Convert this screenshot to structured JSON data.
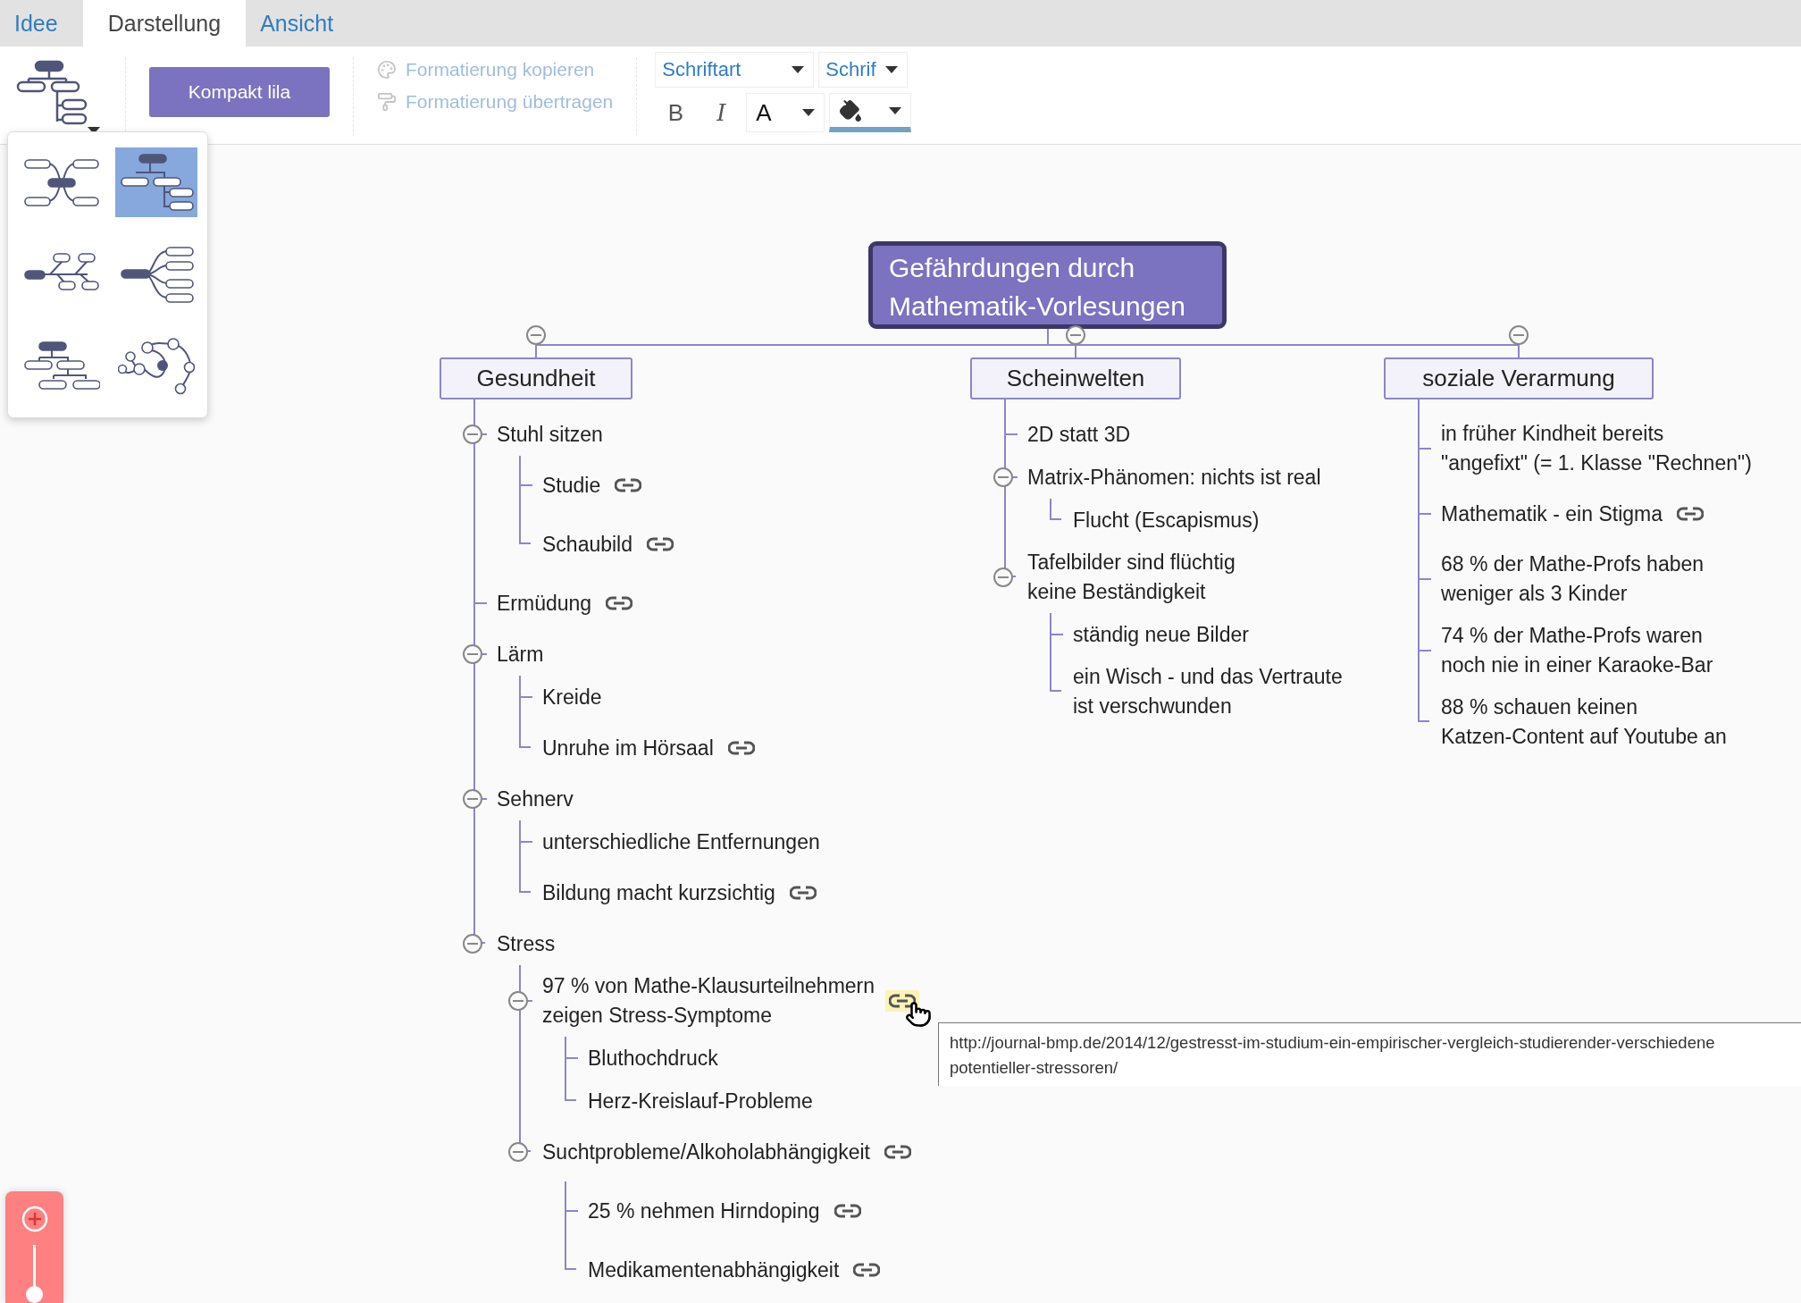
{
  "tabs": [
    {
      "label": "Idee",
      "selected": false
    },
    {
      "label": "Darstellung",
      "selected": true
    },
    {
      "label": "Ansicht",
      "selected": false
    }
  ],
  "toolbar": {
    "theme_button": "Kompakt lila",
    "format_actions": [
      {
        "label": "Formatierung kopieren",
        "disabled": true
      },
      {
        "label": "Formatierung übertragen",
        "disabled": true
      }
    ],
    "font_family": "Schriftart",
    "font_size": "Schrif",
    "bold": "B",
    "italic": "I",
    "text_color": "A"
  },
  "layout_menu": {
    "options": [
      {
        "kind": "mindmap",
        "selected": false
      },
      {
        "kind": "tree-right",
        "selected": true
      },
      {
        "kind": "fishbone",
        "selected": false
      },
      {
        "kind": "radial-right",
        "selected": false
      },
      {
        "kind": "org-chart",
        "selected": false
      },
      {
        "kind": "bubbles",
        "selected": false
      }
    ]
  },
  "map": {
    "root": "Gefährdungen durch\nMathematik-Vorlesungen",
    "branches": [
      {
        "label": "Gesundheit",
        "expanded": true,
        "children": [
          {
            "text": "Stuhl sitzen",
            "expanded": true,
            "children": [
              {
                "text": "Studie",
                "link": true
              },
              {
                "text": "Schaubild",
                "link": true
              }
            ]
          },
          {
            "text": "Ermüdung",
            "link": true
          },
          {
            "text": "Lärm",
            "expanded": true,
            "children": [
              {
                "text": "Kreide"
              },
              {
                "text": "Unruhe im Hörsaal",
                "link": true
              }
            ]
          },
          {
            "text": "Sehnerv",
            "expanded": true,
            "children": [
              {
                "text": "unterschiedliche Entfernungen"
              },
              {
                "text": "Bildung macht kurzsichtig",
                "link": true
              }
            ]
          },
          {
            "text": "Stress",
            "expanded": true,
            "children": [
              {
                "text": "97 % von Mathe-Klausurteilnehmern\nzeigen Stress-Symptome",
                "link": true,
                "hovered": true,
                "expanded": true,
                "children": [
                  {
                    "text": "Bluthochdruck"
                  },
                  {
                    "text": "Herz-Kreislauf-Probleme"
                  }
                ]
              },
              {
                "text": "Suchtprobleme/Alkoholabhängigkeit",
                "link": true,
                "expanded": true,
                "children": [
                  {
                    "text": "25 % nehmen Hirndoping",
                    "link": true
                  },
                  {
                    "text": "Medikamentenabhängigkeit",
                    "link": true
                  }
                ]
              }
            ]
          }
        ]
      },
      {
        "label": "Scheinwelten",
        "expanded": true,
        "children": [
          {
            "text": "2D statt 3D"
          },
          {
            "text": "Matrix-Phänomen: nichts ist real",
            "expanded": true,
            "children": [
              {
                "text": "Flucht (Escapismus)"
              }
            ]
          },
          {
            "text": "Tafelbilder sind flüchtig\nkeine Beständigkeit",
            "expanded": true,
            "children": [
              {
                "text": "ständig neue Bilder"
              },
              {
                "text": "ein Wisch - und das Vertraute\nist verschwunden"
              }
            ]
          }
        ]
      },
      {
        "label": "soziale Verarmung",
        "expanded": true,
        "children": [
          {
            "text": "in früher Kindheit bereits\n\"angefixt\" (= 1. Klasse \"Rechnen\")"
          },
          {
            "text": "Mathematik - ein Stigma",
            "link": true
          },
          {
            "text": "68 % der Mathe-Profs haben\nweniger als 3 Kinder"
          },
          {
            "text": "74 % der Mathe-Profs waren\nnoch nie in einer Karaoke-Bar"
          },
          {
            "text": "88 % schauen keinen\nKatzen-Content auf Youtube an"
          }
        ]
      }
    ]
  },
  "zoom": {
    "level": 0
  },
  "tooltip": {
    "lines": [
      "http://journal-bmp.de/2014/12/gestresst-im-studium-ein-empirischer-vergleich-studierender-verschiedene",
      "potentieller-stressoren/"
    ]
  }
}
